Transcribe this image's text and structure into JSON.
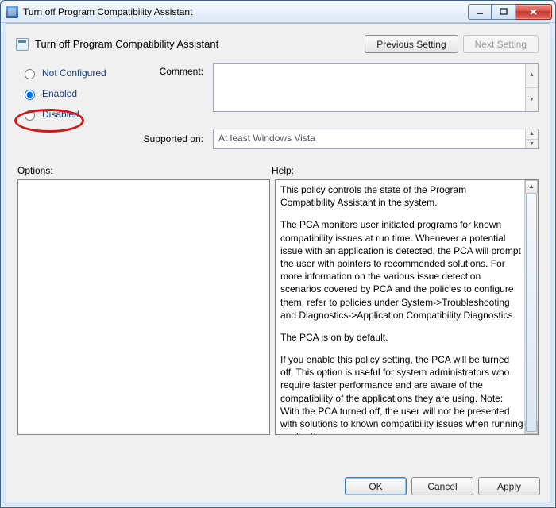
{
  "window": {
    "title": "Turn off Program Compatibility Assistant"
  },
  "header": {
    "title": "Turn off Program Compatibility Assistant",
    "prev_label": "Previous Setting",
    "next_label": "Next Setting"
  },
  "settings": {
    "not_configured_label": "Not Configured",
    "enabled_label": "Enabled",
    "disabled_label": "Disabled",
    "selected": "enabled",
    "comment_label": "Comment:",
    "comment_value": "",
    "supported_label": "Supported on:",
    "supported_value": "At least Windows Vista"
  },
  "panels": {
    "options_label": "Options:",
    "help_label": "Help:"
  },
  "help": {
    "p1": "This policy controls the state of the Program Compatibility Assistant in the system.",
    "p2": "The PCA monitors user initiated programs for known compatibility issues at run time. Whenever a potential issue with an application is detected, the PCA will prompt the user with pointers to recommended solutions.  For more information on the various issue detection scenarios covered by PCA and the policies to configure them, refer to policies under System->Troubleshooting and Diagnostics->Application Compatibility Diagnostics.",
    "p3": "The PCA is on by default.",
    "p4": "If you enable this policy setting, the PCA will be turned off. This option is useful for system administrators who require faster performance and are aware of the compatibility of the applications they are using. Note: With the PCA turned off, the user will not be presented with solutions to known compatibility issues when running applications."
  },
  "footer": {
    "ok": "OK",
    "cancel": "Cancel",
    "apply": "Apply"
  }
}
